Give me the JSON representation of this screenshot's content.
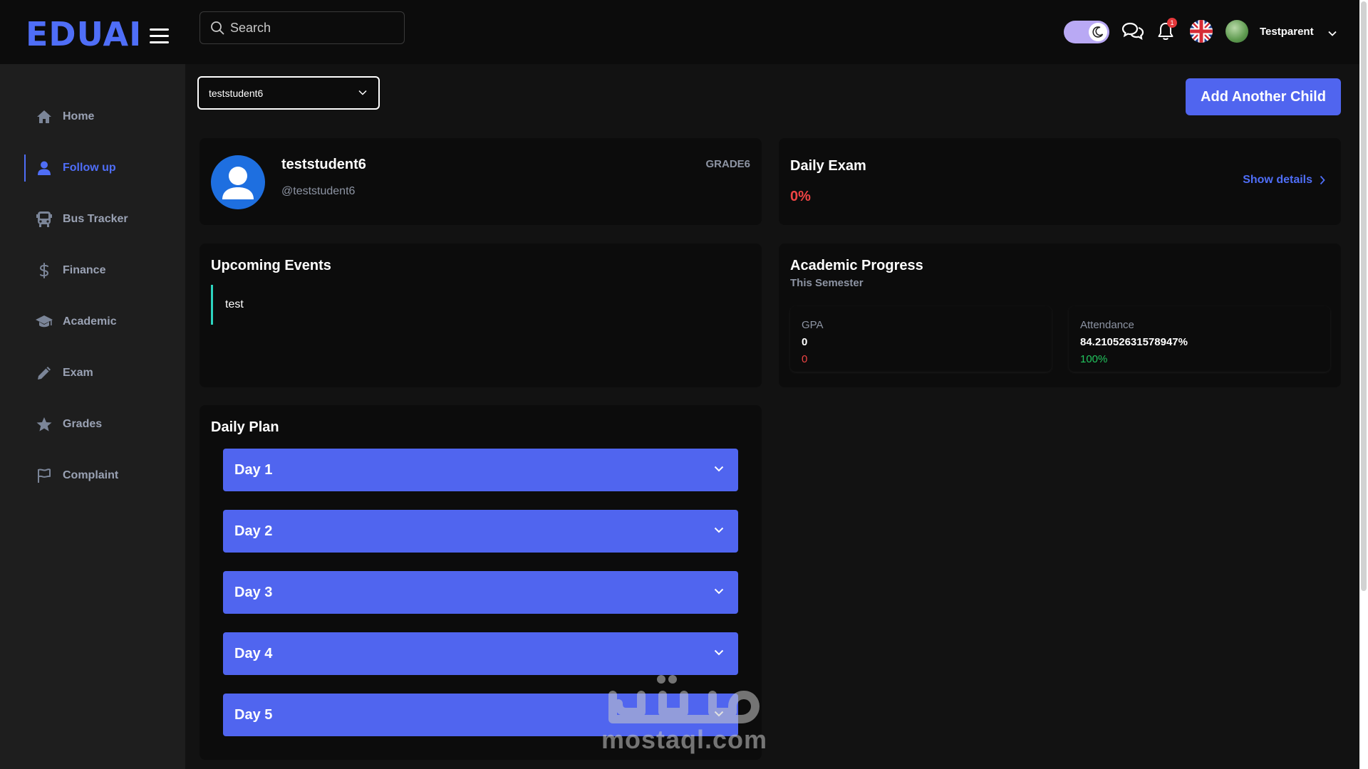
{
  "brand": {
    "logo_text": "EDUAI",
    "accent_color": "#5065ef"
  },
  "sidebar": {
    "items": [
      {
        "label": "Home",
        "icon": "home-icon",
        "active": false
      },
      {
        "label": "Follow up",
        "icon": "user-icon",
        "active": true
      },
      {
        "label": "Bus Tracker",
        "icon": "bus-icon",
        "active": false
      },
      {
        "label": "Finance",
        "icon": "dollar-icon",
        "active": false
      },
      {
        "label": "Academic",
        "icon": "graduation-cap-icon",
        "active": false
      },
      {
        "label": "Exam",
        "icon": "pencil-icon",
        "active": false
      },
      {
        "label": "Grades",
        "icon": "star-icon",
        "active": false
      },
      {
        "label": "Complaint",
        "icon": "flag-icon",
        "active": false
      }
    ]
  },
  "topbar": {
    "search_placeholder": "Search",
    "notification_count": "1",
    "username": "Testparent"
  },
  "child_select": {
    "selected": "teststudent6"
  },
  "add_child_label": "Add Another Child",
  "profile": {
    "name": "teststudent6",
    "handle": "@teststudent6",
    "grade": "GRADE6"
  },
  "daily_exam": {
    "title": "Daily Exam",
    "value": "0%",
    "link_label": "Show details"
  },
  "upcoming_events": {
    "title": "Upcoming Events",
    "items": [
      "test"
    ]
  },
  "academic_progress": {
    "title": "Academic Progress",
    "subtitle": "This Semester",
    "gpa": {
      "label": "GPA",
      "value": "0",
      "sub": "0"
    },
    "attendance": {
      "label": "Attendance",
      "value": "84.21052631578947%",
      "sub": "100%"
    }
  },
  "daily_plan": {
    "title": "Daily Plan",
    "days": [
      "Day 1",
      "Day 2",
      "Day 3",
      "Day 4",
      "Day 5"
    ]
  },
  "watermark": {
    "text": "mostaql.com"
  }
}
